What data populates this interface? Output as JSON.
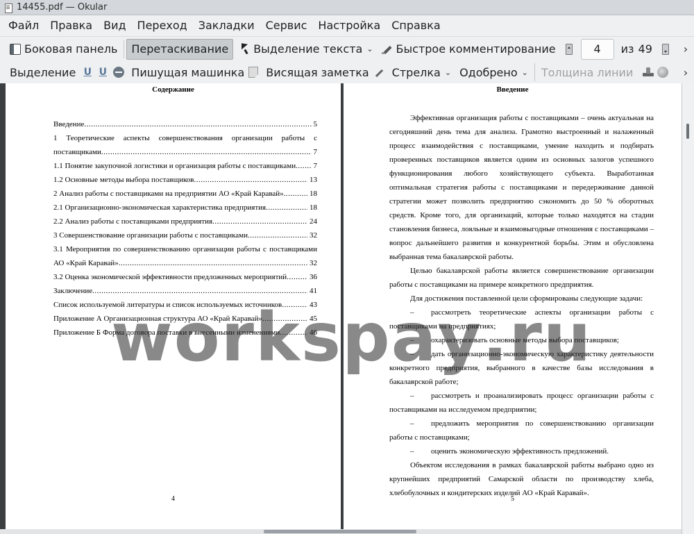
{
  "window": {
    "title": "14455.pdf  — Okular"
  },
  "menu": [
    "Файл",
    "Правка",
    "Вид",
    "Переход",
    "Закладки",
    "Сервис",
    "Настройка",
    "Справка"
  ],
  "toolbar": {
    "sidebar_label": "Боковая панель",
    "drag_label": "Перетаскивание",
    "text_select_label": "Выделение текста",
    "quick_comment_label": "Быстрое комментирование",
    "page_current": "4",
    "page_of_label": "из",
    "page_total": "49"
  },
  "annotation_bar": {
    "highlight_label": "Выделение",
    "typewriter_label": "Пишущая машинка",
    "sticky_note_label": "Висящая заметка",
    "arrow_label": "Стрелка",
    "stamp_label": "Одобрено",
    "line_width_label": "Толщина линии"
  },
  "left_page": {
    "heading": "Содержание",
    "toc": [
      {
        "title": "Введение",
        "page": "5"
      },
      {
        "title": "1 Теоретические аспекты совершенствования организации работы с",
        "title_cont": "поставщиками",
        "page": "7"
      },
      {
        "title": "1.1 Понятие закупочной логистики и организация работы с поставщиками",
        "page": "7"
      },
      {
        "title": "1.2 Основные методы выбора поставщиков",
        "page": "13"
      },
      {
        "title": "2 Анализ работы с поставщиками на предприятии АО «Край Каравай»",
        "page": "18"
      },
      {
        "title": "2.1 Организационно-экономическая характеристика предприятия",
        "page": "18"
      },
      {
        "title": "2.2 Анализ работы с поставщиками предприятия",
        "page": "24"
      },
      {
        "title": "3 Совершенствование организации работы с поставщиками",
        "page": "32"
      },
      {
        "title": "3.1 Мероприятия по совершенствованию организации работы с поставщиками",
        "title_cont": "АО «Край Каравай»",
        "page": "32"
      },
      {
        "title": "3.2 Оценка экономической эффективности предложенных мероприятий",
        "page": "36"
      },
      {
        "title": "Заключение",
        "page": "41"
      },
      {
        "title": "Список используемой литературы и список используемых источников",
        "page": "43"
      },
      {
        "title": "Приложение А Организационная структура АО «Край Каравай»",
        "page": "45"
      },
      {
        "title": "Приложение Б Форма договора поставки в внесенными изменениями",
        "page": "46"
      }
    ],
    "page_number": "4"
  },
  "right_page": {
    "heading": "Введение",
    "paragraphs": [
      "Эффективная организация работы с поставщиками – очень актуальная на сегодняшний день тема для анализа. Грамотно выстроенный и налаженный процесс взаимодействия с поставщиками, умение находить и подбирать проверенных поставщиков является одним из основных залогов успешного функционирования любого хозяйствующего субъекта. Выработанная оптимальная стратегия работы с поставщиками и передерживание данной стратегии может позволить предприятию сэкономить до 50 % оборотных средств. Кроме того, для организаций, которые только находятся на стадии становления бизнеса, лояльные и взаимовыгодные отношения с поставщиками – вопрос дальнейшего развития и конкурентной борьбы. Этим и обусловлена выбранная тема бакалаврской работы.",
      "Целью бакалаврской работы является совершенствование организации работы с поставщиками на примере конкретного предприятия.",
      "Для достижения поставленной цели сформированы следующие задачи:"
    ],
    "dash": "–",
    "tasks": [
      "рассмотреть теоретические аспекты организации работы с поставщиками на предприятиях;",
      "охарактеризовать основные методы выбора поставщиков;",
      "дать организационно-экономическую характеристику деятельности конкретного предприятия, выбранного в качестве базы исследования в бакалаврской работе;",
      "рассмотреть и проанализировать процесс организации работы с поставщиками на исследуемом предприятии;",
      "предложить мероприятия по совершенствованию организации работы с поставщиками;",
      "оценить экономическую эффективность предложений."
    ],
    "closing": "Объектом исследования в рамках бакалаврской работы выбрано одно из крупнейших предприятий Самарской области по производству хлеба, хлебобулочных и кондитерских изделий АО «Край Каравай».",
    "page_number": "5"
  },
  "watermark": "worksрау.ru",
  "icons": {
    "sidebar": "sidebar-icon",
    "text_select": "cursor-icon",
    "quick_comment": "pen-icon",
    "page_up": "page-up-icon",
    "page_down": "page-down-icon",
    "overflow": "chevron-right-icon"
  }
}
